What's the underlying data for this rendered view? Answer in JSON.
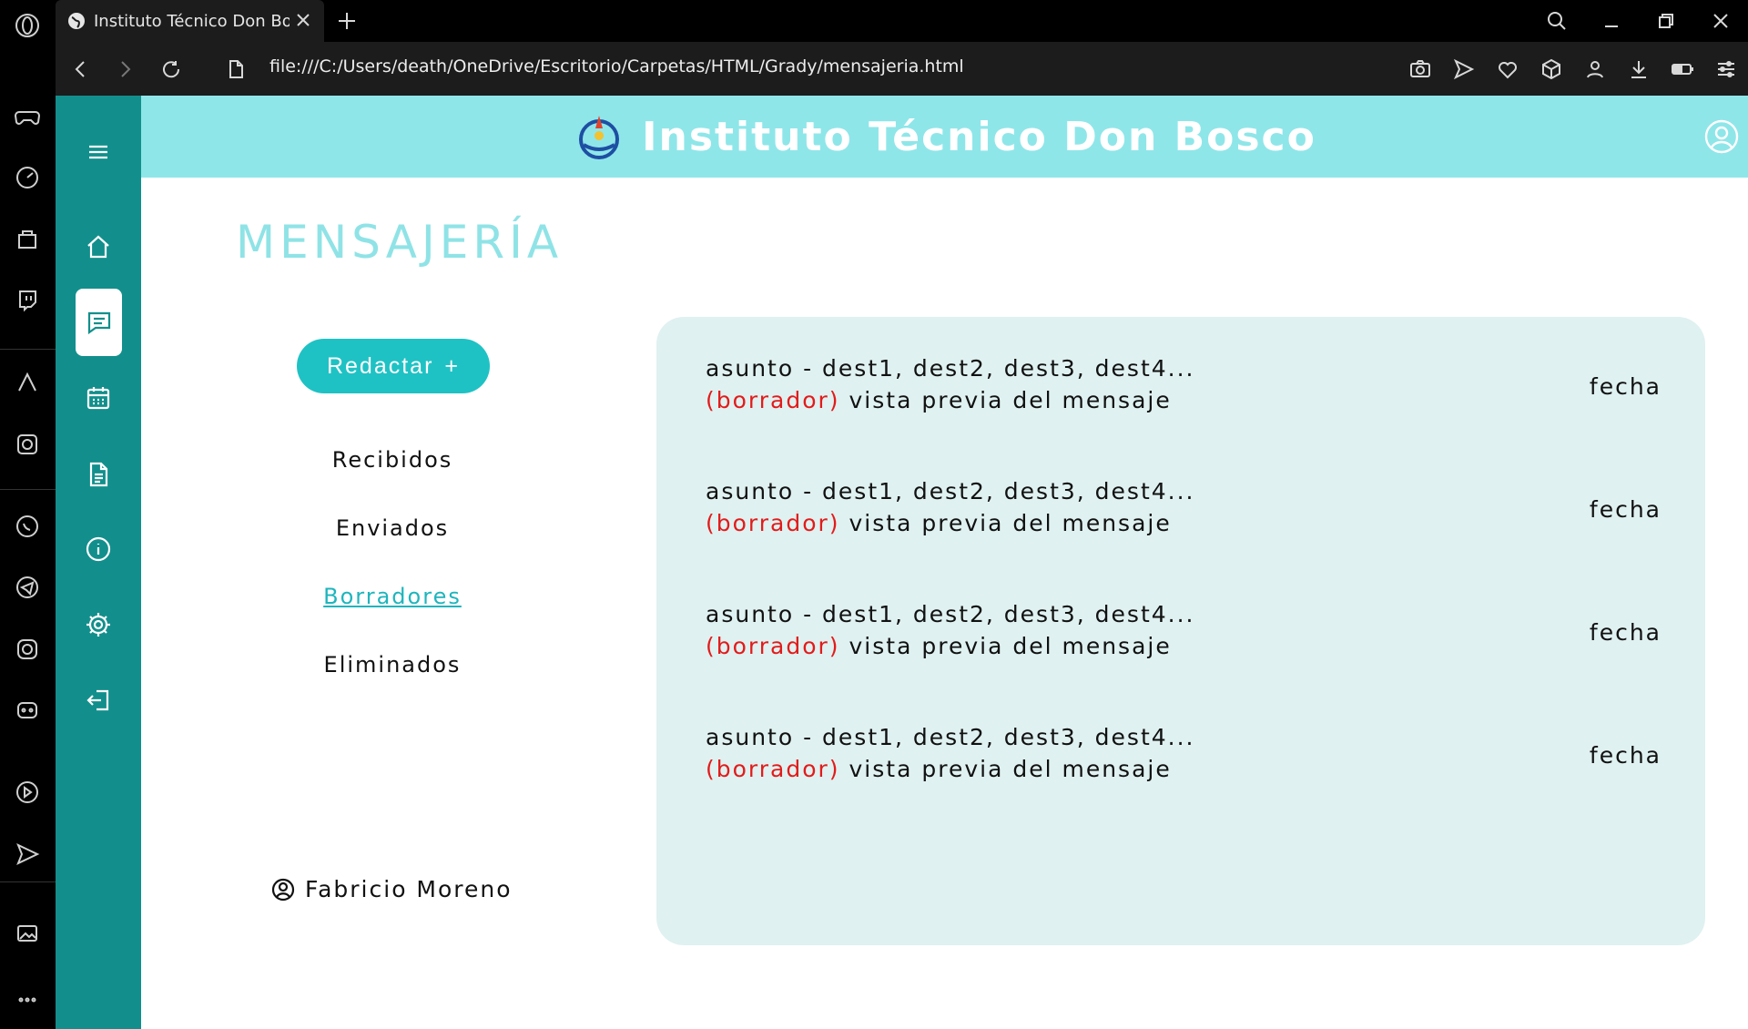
{
  "browser": {
    "tab_title": "Instituto Técnico Don Bosco",
    "url": "file:///C:/Users/death/OneDrive/Escritorio/Carpetas/HTML/Grady/mensajeria.html"
  },
  "opera_sidebar": {
    "icons": [
      "opera-logo-icon",
      "gamepad-icon",
      "speed-dial-icon",
      "shopping-bag-icon",
      "twitch-icon",
      "aria-icon",
      "chatgpt-icon",
      "whatsapp-icon",
      "telegram-icon",
      "instagram-icon",
      "discord-icon",
      "player-icon",
      "send-icon",
      "gallery-icon",
      "more-icon"
    ]
  },
  "site": {
    "title": "Instituto Técnico Don Bosco",
    "page_title": "MENSAJERÍA"
  },
  "nav": {
    "items": [
      "menu-icon",
      "home-icon",
      "messages-icon",
      "calendar-icon",
      "document-icon",
      "info-icon",
      "settings-icon",
      "logout-icon"
    ],
    "active": "messages-icon"
  },
  "compose": {
    "label": "Redactar",
    "plus": "+"
  },
  "folders": [
    {
      "label": "Recibidos",
      "active": false
    },
    {
      "label": "Enviados",
      "active": false
    },
    {
      "label": "Borradores",
      "active": true
    },
    {
      "label": "Eliminados",
      "active": false
    }
  ],
  "user": {
    "name": "Fabricio Moreno"
  },
  "messages": [
    {
      "subject": "asunto - dest1, dest2, dest3, dest4...",
      "tag": "(borrador)",
      "preview": "vista previa del mensaje",
      "date": "fecha"
    },
    {
      "subject": "asunto - dest1, dest2, dest3, dest4...",
      "tag": "(borrador)",
      "preview": "vista previa del mensaje",
      "date": "fecha"
    },
    {
      "subject": "asunto - dest1, dest2, dest3, dest4...",
      "tag": "(borrador)",
      "preview": "vista previa del mensaje",
      "date": "fecha"
    },
    {
      "subject": "asunto - dest1, dest2, dest3, dest4...",
      "tag": "(borrador)",
      "preview": "vista previa del mensaje",
      "date": "fecha"
    }
  ],
  "colors": {
    "nav": "#128f8c",
    "banner": "#8fe6e9",
    "accent": "#1fc2c4",
    "panel": "#dff1f0",
    "draft": "#e21b1b"
  }
}
